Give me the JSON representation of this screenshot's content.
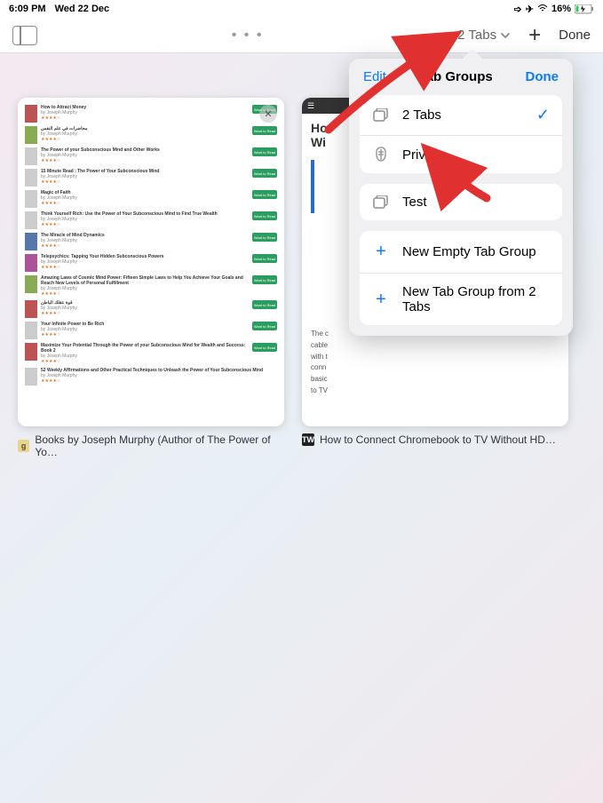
{
  "status": {
    "time": "6:09 PM",
    "date": "Wed 22 Dec",
    "battery_pct": "16%"
  },
  "toolbar": {
    "tabs_label": "2 Tabs",
    "done": "Done",
    "center_dots": "• • •"
  },
  "thumbs": [
    {
      "caption": "Books by Joseph Murphy (Author of The Power of Yo…",
      "favicon_letter": "g"
    },
    {
      "caption": "How to Connect Chromebook to TV Without HD…",
      "favicon_letter": "TW",
      "article_title_visible_prefix": "Ho",
      "article_title_visible_line2": "Wi"
    }
  ],
  "gr_books": [
    {
      "title": "How to Attract Money",
      "author": "by Joseph Murphy"
    },
    {
      "title": "محاضرات في علم النفس",
      "author": "by Joseph Murphy"
    },
    {
      "title": "The Power of your Subconscious Mind and Other Works",
      "author": "by Joseph Murphy"
    },
    {
      "title": "15 Minute Read : The Power of Your Subconscious Mind",
      "author": "by Joseph Murphy"
    },
    {
      "title": "Magic of Faith",
      "author": "by Joseph Murphy"
    },
    {
      "title": "Think Yourself Rich: Use the Power of Your Subconscious Mind to Find True Wealth",
      "author": "by Joseph Murphy"
    },
    {
      "title": "The Miracle of Mind Dynamics",
      "author": "by Joseph Murphy"
    },
    {
      "title": "Telepsychics: Tapping Your Hidden Subconscious Powers",
      "author": "by Joseph Murphy"
    },
    {
      "title": "Amazing Laws of Cosmic Mind Power: Fifteen Simple Laws to Help You Achieve Your Goals and Reach New Levels of Personal Fulfillment",
      "author": "by Joseph Murphy"
    },
    {
      "title": "قوة عقلك الباطن",
      "author": "by Joseph Murphy"
    },
    {
      "title": "Your Infinite Power to Be Rich",
      "author": "by Joseph Murphy"
    },
    {
      "title": "Maximize Your Potential Through the Power of your Subconscious Mind for Wealth and Success: Book 2",
      "author": "by Joseph Murphy"
    },
    {
      "title": "52 Weekly Affirmations and Other Practical Techniques to Unleash the Power of Your Subconscious Mind",
      "author": "by Joseph Murphy"
    }
  ],
  "gr_btn_label": "Want to Read",
  "article_text": {
    "line1": "The c",
    "line2": "cable",
    "line3": "with t",
    "line4": "conn",
    "line5": "basic",
    "line6": "to TV"
  },
  "popover": {
    "edit": "Edit",
    "title": "Tab Groups",
    "done": "Done",
    "row_2tabs": "2 Tabs",
    "row_private": "Private",
    "row_test": "Test",
    "row_new_empty": "New Empty Tab Group",
    "row_new_from": "New Tab Group from 2 Tabs"
  }
}
